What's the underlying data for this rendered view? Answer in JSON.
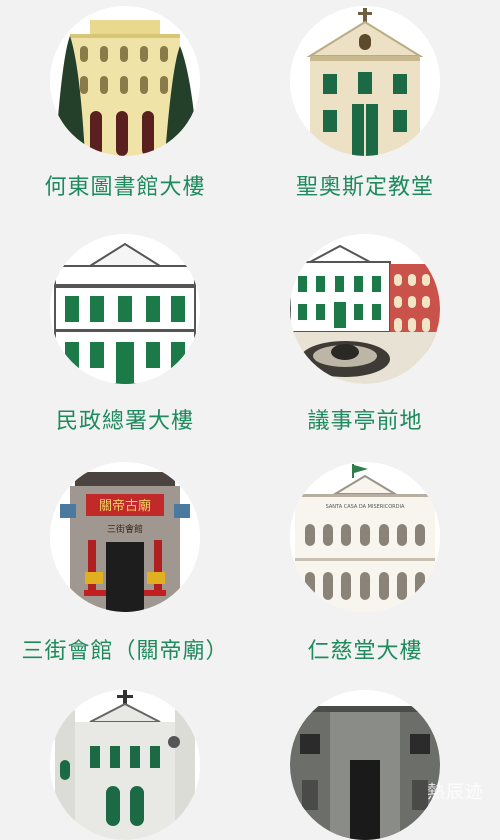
{
  "colors": {
    "label": "#1e8a5e",
    "background": "#f2f2f2",
    "accent_green": "#1b7a47"
  },
  "buildings": [
    {
      "label": "何東圖書館大樓",
      "icon": "library-building-icon"
    },
    {
      "label": "聖奧斯定教堂",
      "icon": "church-icon"
    },
    {
      "label": "民政總署大樓",
      "icon": "civic-building-icon"
    },
    {
      "label": "議事亭前地",
      "icon": "senado-square-icon"
    },
    {
      "label": "三街會館（關帝廟）",
      "icon": "temple-icon"
    },
    {
      "label": "仁慈堂大樓",
      "icon": "holy-house-icon"
    },
    {
      "label": "",
      "icon": "cathedral-icon"
    },
    {
      "label": "",
      "icon": "gate-building-icon"
    }
  ],
  "temple_sign": {
    "top": "關帝古廟",
    "sub": "三街會館"
  },
  "mercy_sign": "SANTA CASA DA MISERICORDIA",
  "watermark": "熱辰迹"
}
